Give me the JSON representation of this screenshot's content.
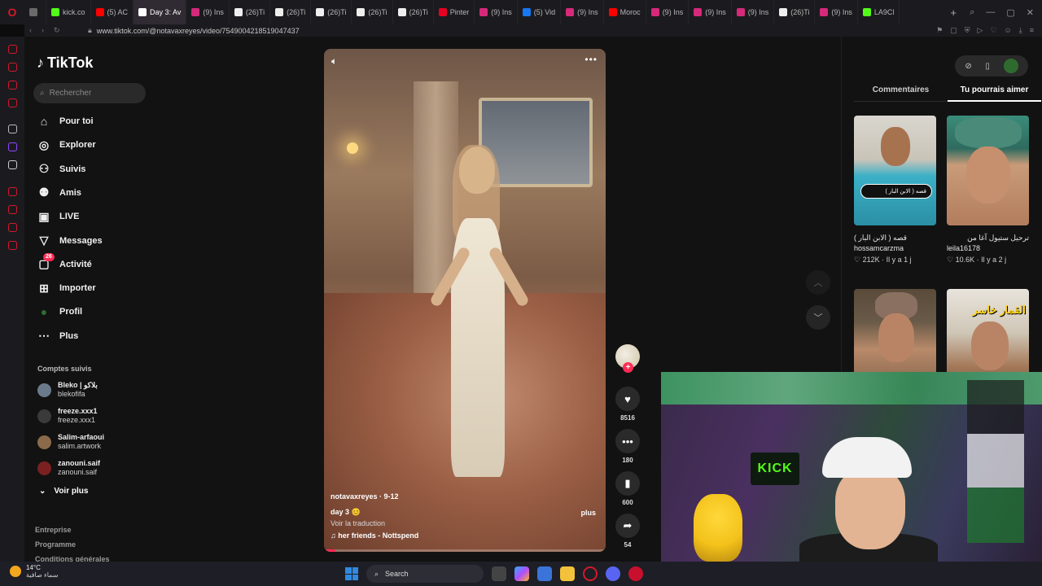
{
  "browser": {
    "tabs": [
      {
        "label": "",
        "color": "#6a6a6a",
        "active": false
      },
      {
        "label": "kick.co",
        "color": "#53fc18",
        "active": false
      },
      {
        "label": "(5) AC",
        "color": "#ff0000",
        "active": false
      },
      {
        "label": "Day 3: Av",
        "color": "#ffffff",
        "active": true
      },
      {
        "label": "(9) Ins",
        "color": "#d6297a",
        "active": false
      },
      {
        "label": "(26)Ti",
        "color": "#eeeeee",
        "active": false
      },
      {
        "label": "(26)Ti",
        "color": "#eeeeee",
        "active": false
      },
      {
        "label": "(26)Ti",
        "color": "#eeeeee",
        "active": false
      },
      {
        "label": "(26)Ti",
        "color": "#eeeeee",
        "active": false
      },
      {
        "label": "(26)Ti",
        "color": "#eeeeee",
        "active": false
      },
      {
        "label": "Pinter",
        "color": "#e60023",
        "active": false
      },
      {
        "label": "(9) Ins",
        "color": "#d6297a",
        "active": false
      },
      {
        "label": "(5) Vid",
        "color": "#1877f2",
        "active": false
      },
      {
        "label": "(9) Ins",
        "color": "#d6297a",
        "active": false
      },
      {
        "label": "Moroc",
        "color": "#ff0000",
        "active": false
      },
      {
        "label": "(9) Ins",
        "color": "#d6297a",
        "active": false
      },
      {
        "label": "(9) Ins",
        "color": "#d6297a",
        "active": false
      },
      {
        "label": "(9) Ins",
        "color": "#d6297a",
        "active": false
      },
      {
        "label": "(26)Ti",
        "color": "#eeeeee",
        "active": false
      },
      {
        "label": "(9) Ins",
        "color": "#d6297a",
        "active": false
      },
      {
        "label": "LA9Cl",
        "color": "#53fc18",
        "active": false
      }
    ],
    "url": "www.tiktok.com/@notavaxreyes/video/7549004218519047437"
  },
  "tiktok": {
    "logo": "TikTok",
    "search_placeholder": "Rechercher",
    "nav": [
      {
        "label": "Pour toi",
        "icon": "home-icon"
      },
      {
        "label": "Explorer",
        "icon": "compass-icon"
      },
      {
        "label": "Suivis",
        "icon": "following-icon"
      },
      {
        "label": "Amis",
        "icon": "friends-icon"
      },
      {
        "label": "LIVE",
        "icon": "live-icon"
      },
      {
        "label": "Messages",
        "icon": "messages-icon"
      },
      {
        "label": "Activité",
        "icon": "activity-icon",
        "badge": "26"
      },
      {
        "label": "Importer",
        "icon": "upload-icon"
      },
      {
        "label": "Profil",
        "icon": "profile-avatar-icon"
      },
      {
        "label": "Plus",
        "icon": "more-icon"
      }
    ],
    "following_title": "Comptes suivis",
    "following": [
      {
        "name": "Bleko | بلاكو",
        "handle": "blekofifa",
        "color": "#6b7a8a"
      },
      {
        "name": "freeze.xxx1",
        "handle": "freeze.xxx1",
        "color": "#3a3a3a"
      },
      {
        "name": "Salim-arfaoui",
        "handle": "salim.artwork",
        "color": "#8a6a4a"
      },
      {
        "name": "zanouni.saif",
        "handle": "zanouni.saif",
        "color": "#7a2020"
      }
    ],
    "see_more": "Voir plus",
    "footer": [
      "Entreprise",
      "Programme",
      "Conditions générales"
    ]
  },
  "video": {
    "author": "notavaxreyes",
    "date": "9-12",
    "caption": "day 3 😊",
    "translate": "Voir la traduction",
    "sound": "her friends - Nottspend",
    "more": "plus",
    "progress_fraction": 0.04,
    "likes": "8516",
    "comments": "180",
    "saves": "600",
    "shares": "54"
  },
  "right_panel": {
    "tabs": [
      "Commentaires",
      "Tu pourrais aimer"
    ],
    "active_tab": 1,
    "cards": [
      {
        "title": "قصه ( الابن البار )",
        "author": "hossamcarzma",
        "likes": "212K",
        "age": "Il y a 1 j",
        "overlay": "قصه ( الابن البار )"
      },
      {
        "title": "ترحيل ستيول آغا من الكويت بعد تحوّله المفاجئ...",
        "author": "leila16178",
        "likes": "10.6K",
        "age": "Il y a 2 j",
        "overlay": ""
      },
      {
        "title": "",
        "author": "",
        "likes": "",
        "age": "",
        "overlay": ""
      },
      {
        "title": "",
        "author": "",
        "likes": "",
        "age": "",
        "overlay": "القمار خاسر"
      }
    ]
  },
  "webcam": {
    "sign": "KICK"
  },
  "taskbar": {
    "temp": "14°C",
    "weather": "سماء صافية",
    "search": "Search"
  }
}
